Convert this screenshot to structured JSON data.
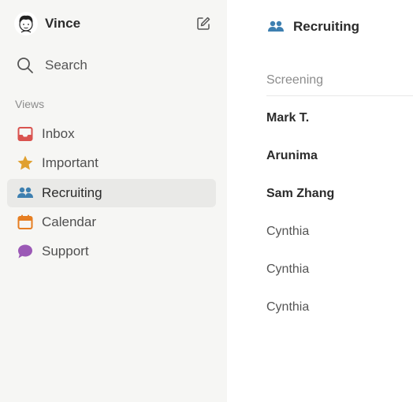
{
  "user": {
    "name": "Vince"
  },
  "search": {
    "label": "Search"
  },
  "views": {
    "header": "Views",
    "items": [
      {
        "label": "Inbox",
        "icon": "inbox-icon",
        "color": "#d9534f"
      },
      {
        "label": "Important",
        "icon": "star-icon",
        "color": "#e0a030"
      },
      {
        "label": "Recruiting",
        "icon": "people-icon",
        "color": "#3d7fb0",
        "active": true
      },
      {
        "label": "Calendar",
        "icon": "calendar-icon",
        "color": "#e67e22"
      },
      {
        "label": "Support",
        "icon": "chat-bubble-icon",
        "color": "#9b59b6"
      }
    ]
  },
  "main": {
    "title": "Recruiting",
    "section": "Screening",
    "items": [
      {
        "name": "Mark T.",
        "unread": true
      },
      {
        "name": "Arunima",
        "unread": true
      },
      {
        "name": "Sam Zhang",
        "unread": true
      },
      {
        "name": "Cynthia",
        "unread": false
      },
      {
        "name": "Cynthia",
        "unread": false
      },
      {
        "name": "Cynthia",
        "unread": false
      }
    ]
  }
}
